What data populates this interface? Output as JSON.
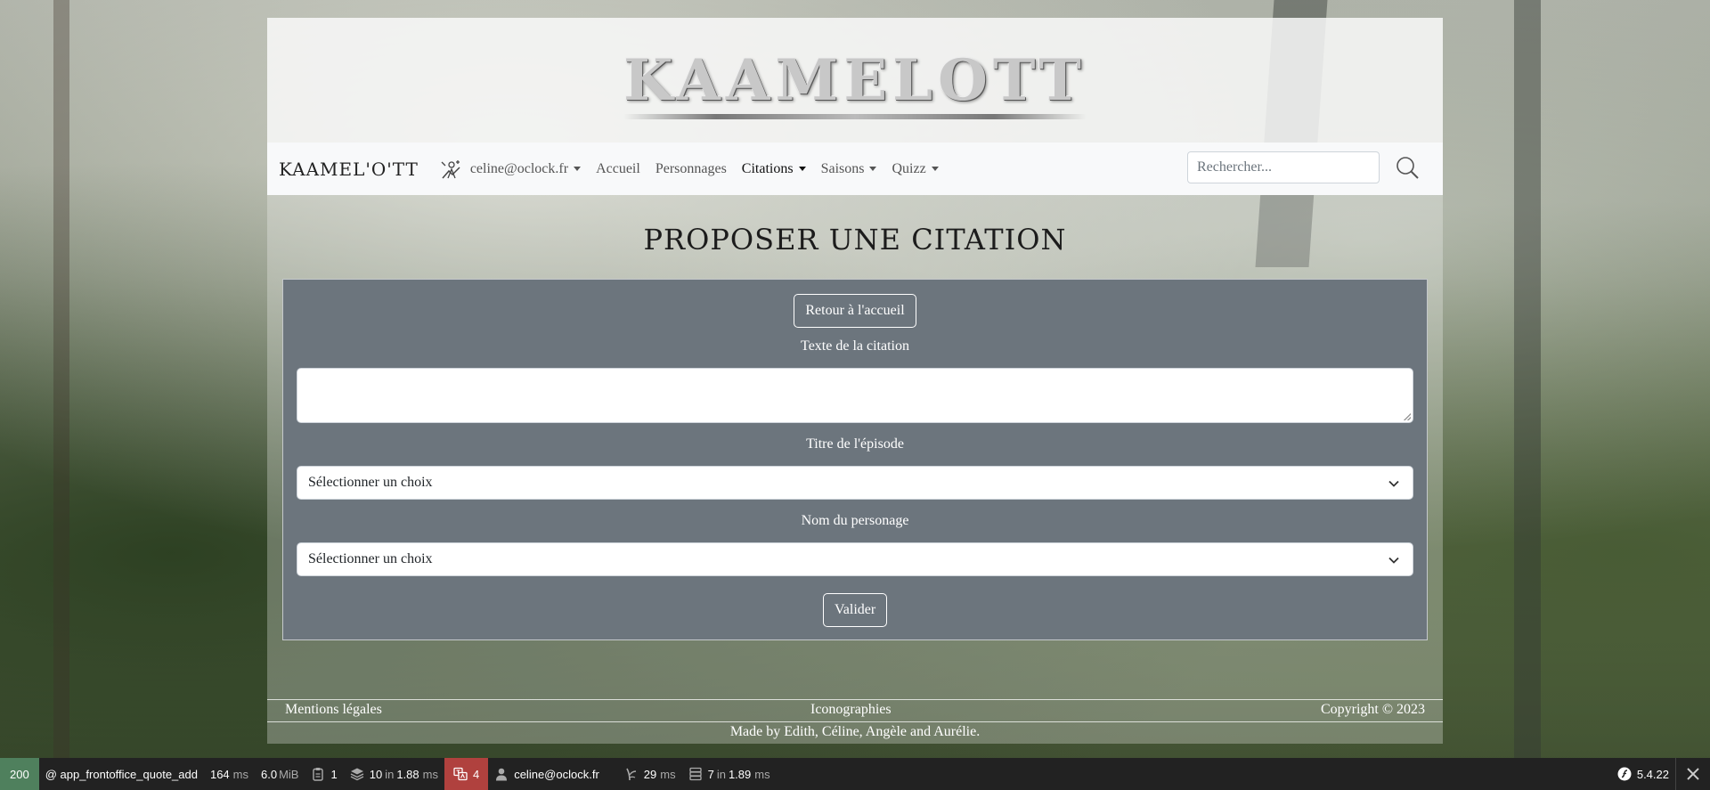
{
  "banner": {
    "logo_text": "KAAMELOTT"
  },
  "navbar": {
    "brand": "KAAMEL'O'TT",
    "user_label": "celine@oclock.fr",
    "items": [
      {
        "label": "Accueil"
      },
      {
        "label": "Personnages"
      },
      {
        "label": "Citations"
      },
      {
        "label": "Saisons"
      },
      {
        "label": "Quizz"
      }
    ],
    "search_placeholder": "Rechercher..."
  },
  "page": {
    "title": "PROPOSER UNE CITATION",
    "back_button": "Retour à l'accueil",
    "quote_text_label": "Texte de la citation",
    "quote_text_value": "",
    "episode_label": "Titre de l'épisode",
    "episode_value": "Sélectionner un choix",
    "character_label": "Nom du personage",
    "character_value": "Sélectionner un choix",
    "submit_button": "Valider"
  },
  "footer": {
    "legal": "Mentions légales",
    "iconography": "Iconographies",
    "copyright": "Copyright © 2023",
    "credits": "Made by Edith, Céline, Angèle and Aurélie."
  },
  "debug_toolbar": {
    "status_code": "200",
    "route": "@ app_frontoffice_quote_add",
    "time_value": "164",
    "time_unit": "ms",
    "memory_value": "6.0",
    "memory_unit": "MiB",
    "logs_count": "1",
    "cache_count": "10",
    "cache_in": "in",
    "cache_time": "1.88",
    "cache_unit": "ms",
    "translation_count": "4",
    "user": "celine@oclock.fr",
    "twig_time": "29",
    "twig_unit": "ms",
    "db_count": "7",
    "db_in": "in",
    "db_time": "1.89",
    "db_unit": "ms",
    "symfony_version": "5.4.22"
  },
  "colors": {
    "form_background": "#6c757d",
    "navbar_background": "#f8f9fa",
    "toolbar_status": "#4f805d",
    "toolbar_danger": "#b0413e"
  }
}
